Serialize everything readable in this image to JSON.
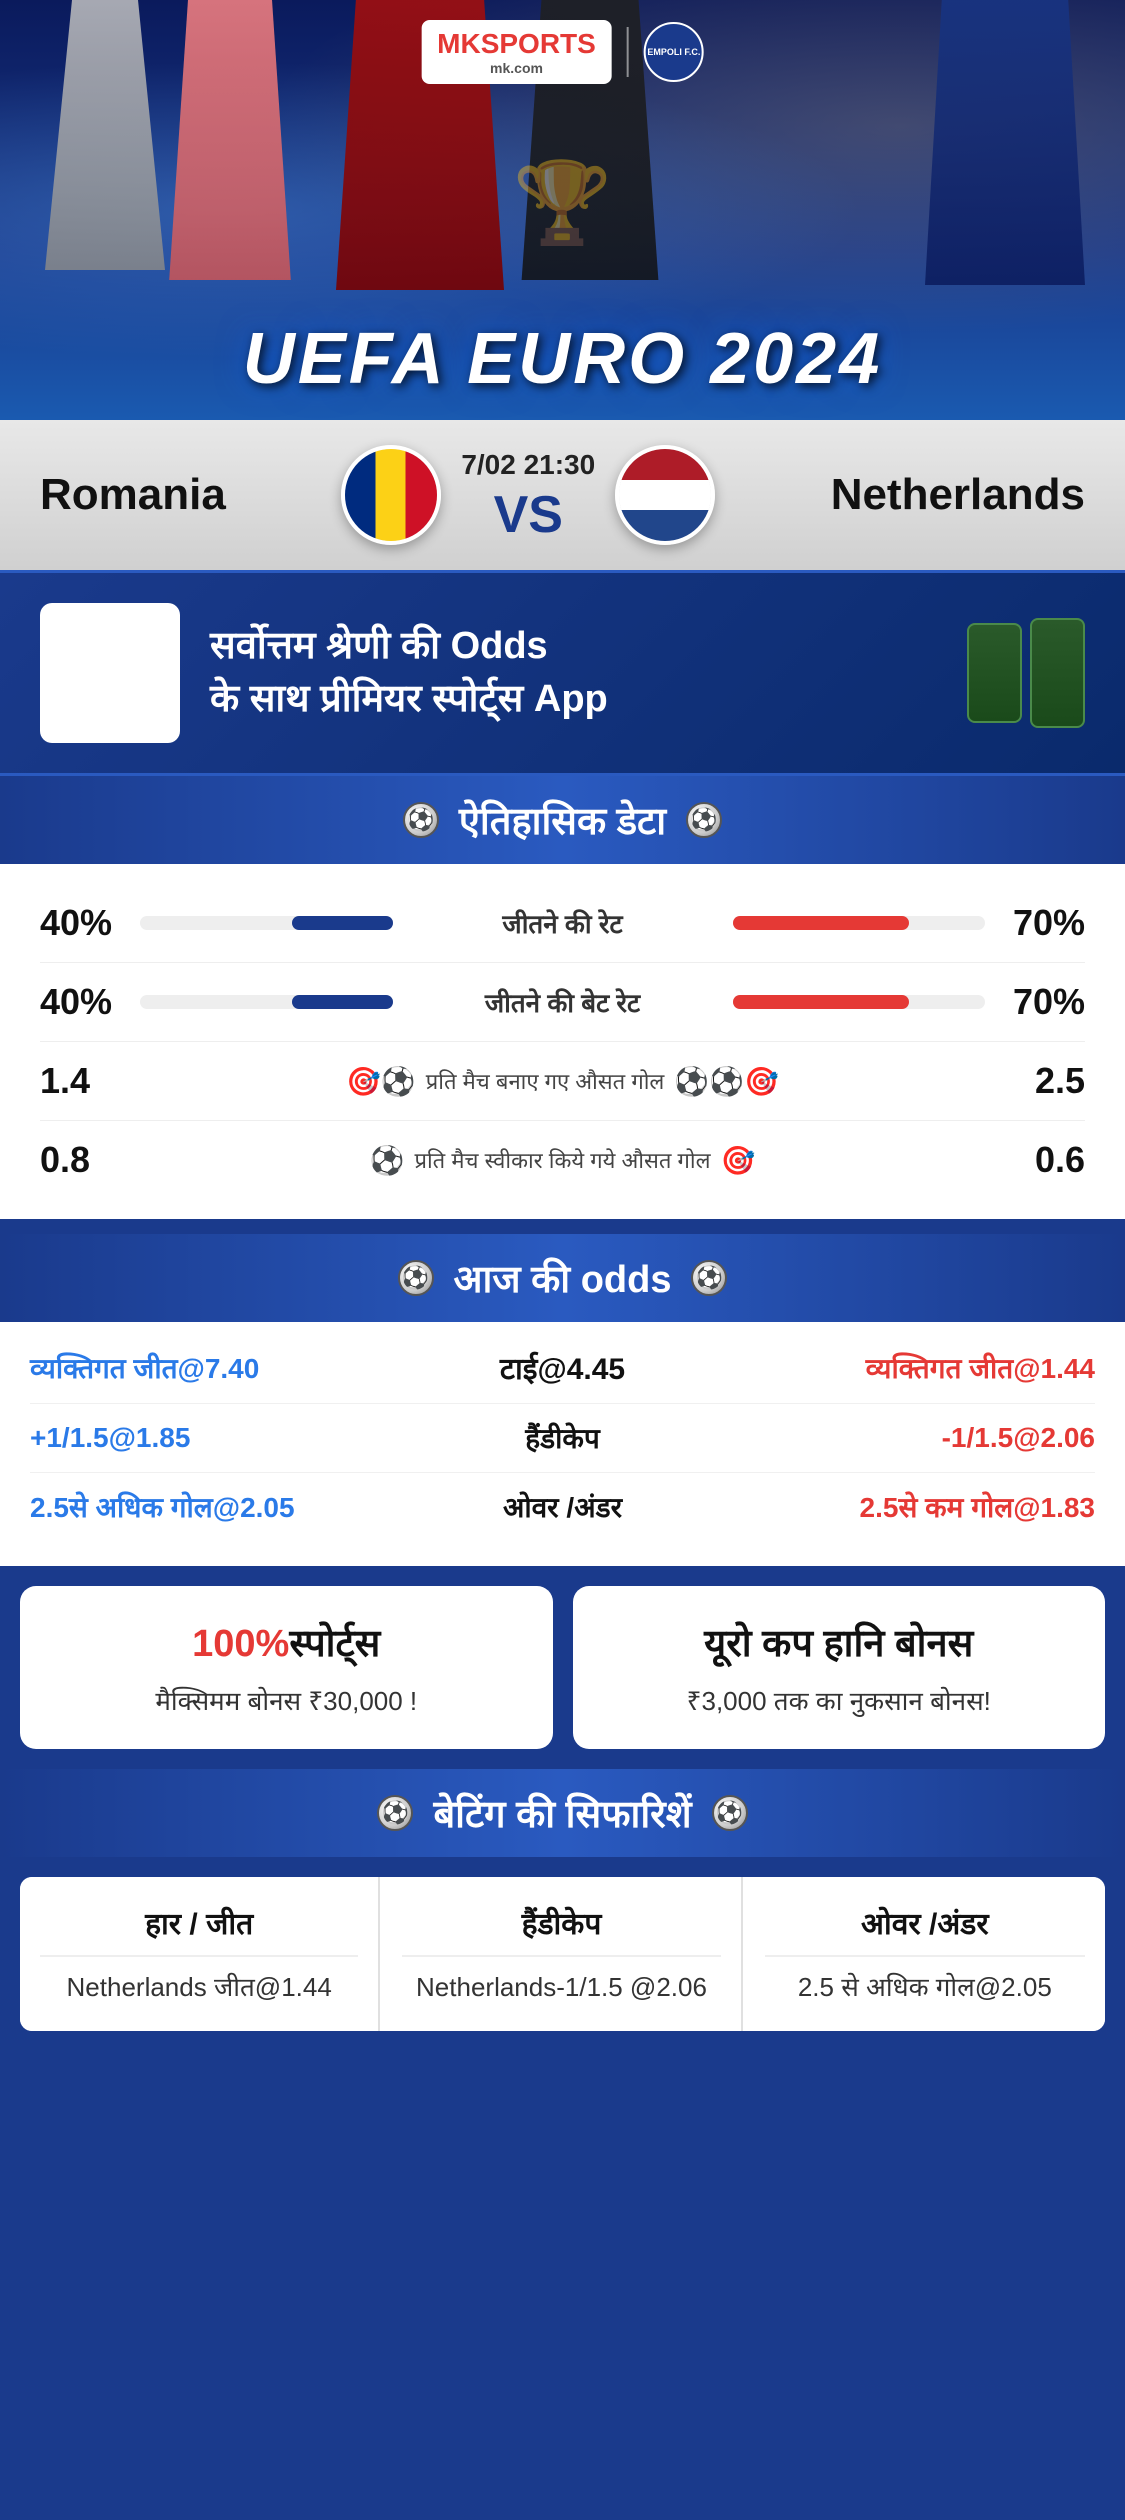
{
  "brand": {
    "mk_label": "MK",
    "sports_label": "SPORTS",
    "mk_com": "mk.com",
    "divider": "|",
    "empoli": "EMPOLI F.C."
  },
  "hero": {
    "title": "UEFA EURO 2024"
  },
  "match": {
    "team_left": "Romania",
    "team_right": "Netherlands",
    "date": "7/02 21:30",
    "vs": "VS"
  },
  "app_promo": {
    "line1": "सर्वोत्तम श्रेणी की",
    "bold1": "Odds",
    "line2": "के साथ प्रीमियर स्पोर्ट्स",
    "bold2": "App"
  },
  "historical_data": {
    "header": "ऐतिहासिक डेटा",
    "win_rate_label": "जीतने की रेट",
    "win_rate_left": "40%",
    "win_rate_right": "70%",
    "win_rate_left_pct": 40,
    "win_rate_right_pct": 70,
    "bet_rate_label": "जीतने की बेट रेट",
    "bet_rate_left": "40%",
    "bet_rate_right": "70%",
    "bet_rate_left_pct": 40,
    "bet_rate_right_pct": 70,
    "avg_goals_label": "प्रति मैच बनाए गए औसत गोल",
    "avg_goals_left": "1.4",
    "avg_goals_right": "2.5",
    "avg_concede_label": "प्रति मैच स्वीकार किये गये औसत गोल",
    "avg_concede_left": "0.8",
    "avg_concede_right": "0.6"
  },
  "odds": {
    "header": "आज की odds",
    "row1": {
      "left": "व्यक्तिगत जीत@7.40",
      "center": "टाई@4.45",
      "right": "व्यक्तिगत जीत@1.44"
    },
    "row2": {
      "left": "+1/1.5@1.85",
      "center": "हैंडीकेप",
      "right": "-1/1.5@2.06"
    },
    "row3": {
      "left": "2.5से अधिक गोल@2.05",
      "center": "ओवर /अंडर",
      "right": "2.5से कम गोल@1.83"
    }
  },
  "bonus": {
    "card1_title_red": "100%",
    "card1_title_black": "स्पोर्ट्स",
    "card1_desc": "मैक्सिमम बोनस  ₹30,000 !",
    "card2_title": "यूरो कप हानि बोनस",
    "card2_desc": "₹3,000 तक का नुकसान बोनस!"
  },
  "betting_recommendations": {
    "header": "बेटिंग की सिफारिशें",
    "col1_header": "हार / जीत",
    "col1_value": "Netherlands जीत@1.44",
    "col2_header": "हैंडीकेप",
    "col2_value": "Netherlands-1/1.5 @2.06",
    "col3_header": "ओवर /अंडर",
    "col3_value": "2.5 से अधिक गोल@2.05"
  },
  "icons": {
    "soccer_ball": "⚽",
    "goal_icons_left": "🎯⚽",
    "goal_icons_right": "⚽⚽🎯",
    "concede_icons_left": "⚽",
    "concede_icons_right": "🎯"
  }
}
